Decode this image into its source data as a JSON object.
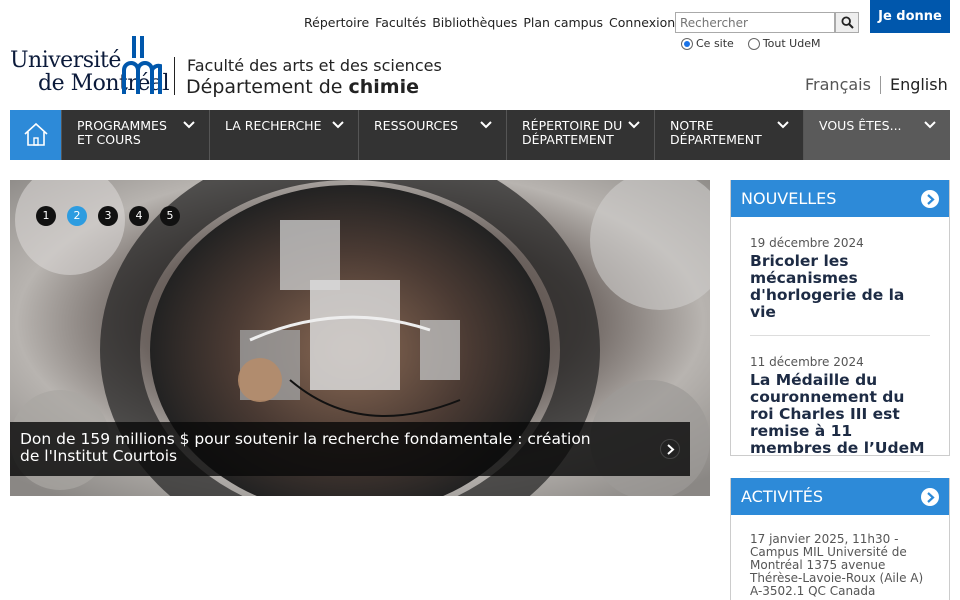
{
  "topnav": {
    "items": [
      "Répertoire",
      "Facultés",
      "Bibliothèques",
      "Plan campus"
    ],
    "login": "Connexion"
  },
  "search": {
    "placeholder": "Rechercher",
    "scope_site": "Ce site",
    "scope_all": "Tout UdeM",
    "selected": "Ce site"
  },
  "donate_label": "Je donne",
  "logo": {
    "line1": "Université",
    "line2": "de Montréal"
  },
  "header": {
    "faculty": "Faculté des arts et des sciences",
    "department_prefix": "Département de",
    "department_name": "chimie"
  },
  "lang": {
    "fr": "Français",
    "en": "English"
  },
  "nav": {
    "items": [
      {
        "line1": "Programmes",
        "line2": "et cours"
      },
      {
        "line1": "La recherche",
        "line2": ""
      },
      {
        "line1": "Ressources",
        "line2": ""
      },
      {
        "line1": "Répertoire du",
        "line2": "département"
      },
      {
        "line1": "Notre",
        "line2": "département"
      },
      {
        "line1": "Vous êtes...",
        "line2": ""
      }
    ]
  },
  "hero": {
    "slides": [
      "1",
      "2",
      "3",
      "4",
      "5"
    ],
    "active_slide": 2,
    "caption": "Don de 159 millions $ pour soutenir la recherche fondamentale : création de l'Institut Courtois"
  },
  "news": {
    "heading": "NOUVELLES",
    "items": [
      {
        "date": "19 décembre 2024",
        "title": "Bricoler les mécanismes d'horlogerie de la vie"
      },
      {
        "date": "11 décembre 2024",
        "title": "La Médaille du couronnement du roi Charles III est remise à 11 membres de l’UdeM"
      }
    ]
  },
  "activities": {
    "heading": "ACTIVITÉS",
    "first_text": "17 janvier 2025, 11h30 - Campus MIL Université de Montréal 1375 avenue Thérèse-Lavoie-Roux (Aile A) A-3502.1 QC Canada"
  },
  "colors": {
    "brand_blue": "#2d8ad8",
    "donate_blue": "#0057ac",
    "nav_dark": "#333333"
  }
}
